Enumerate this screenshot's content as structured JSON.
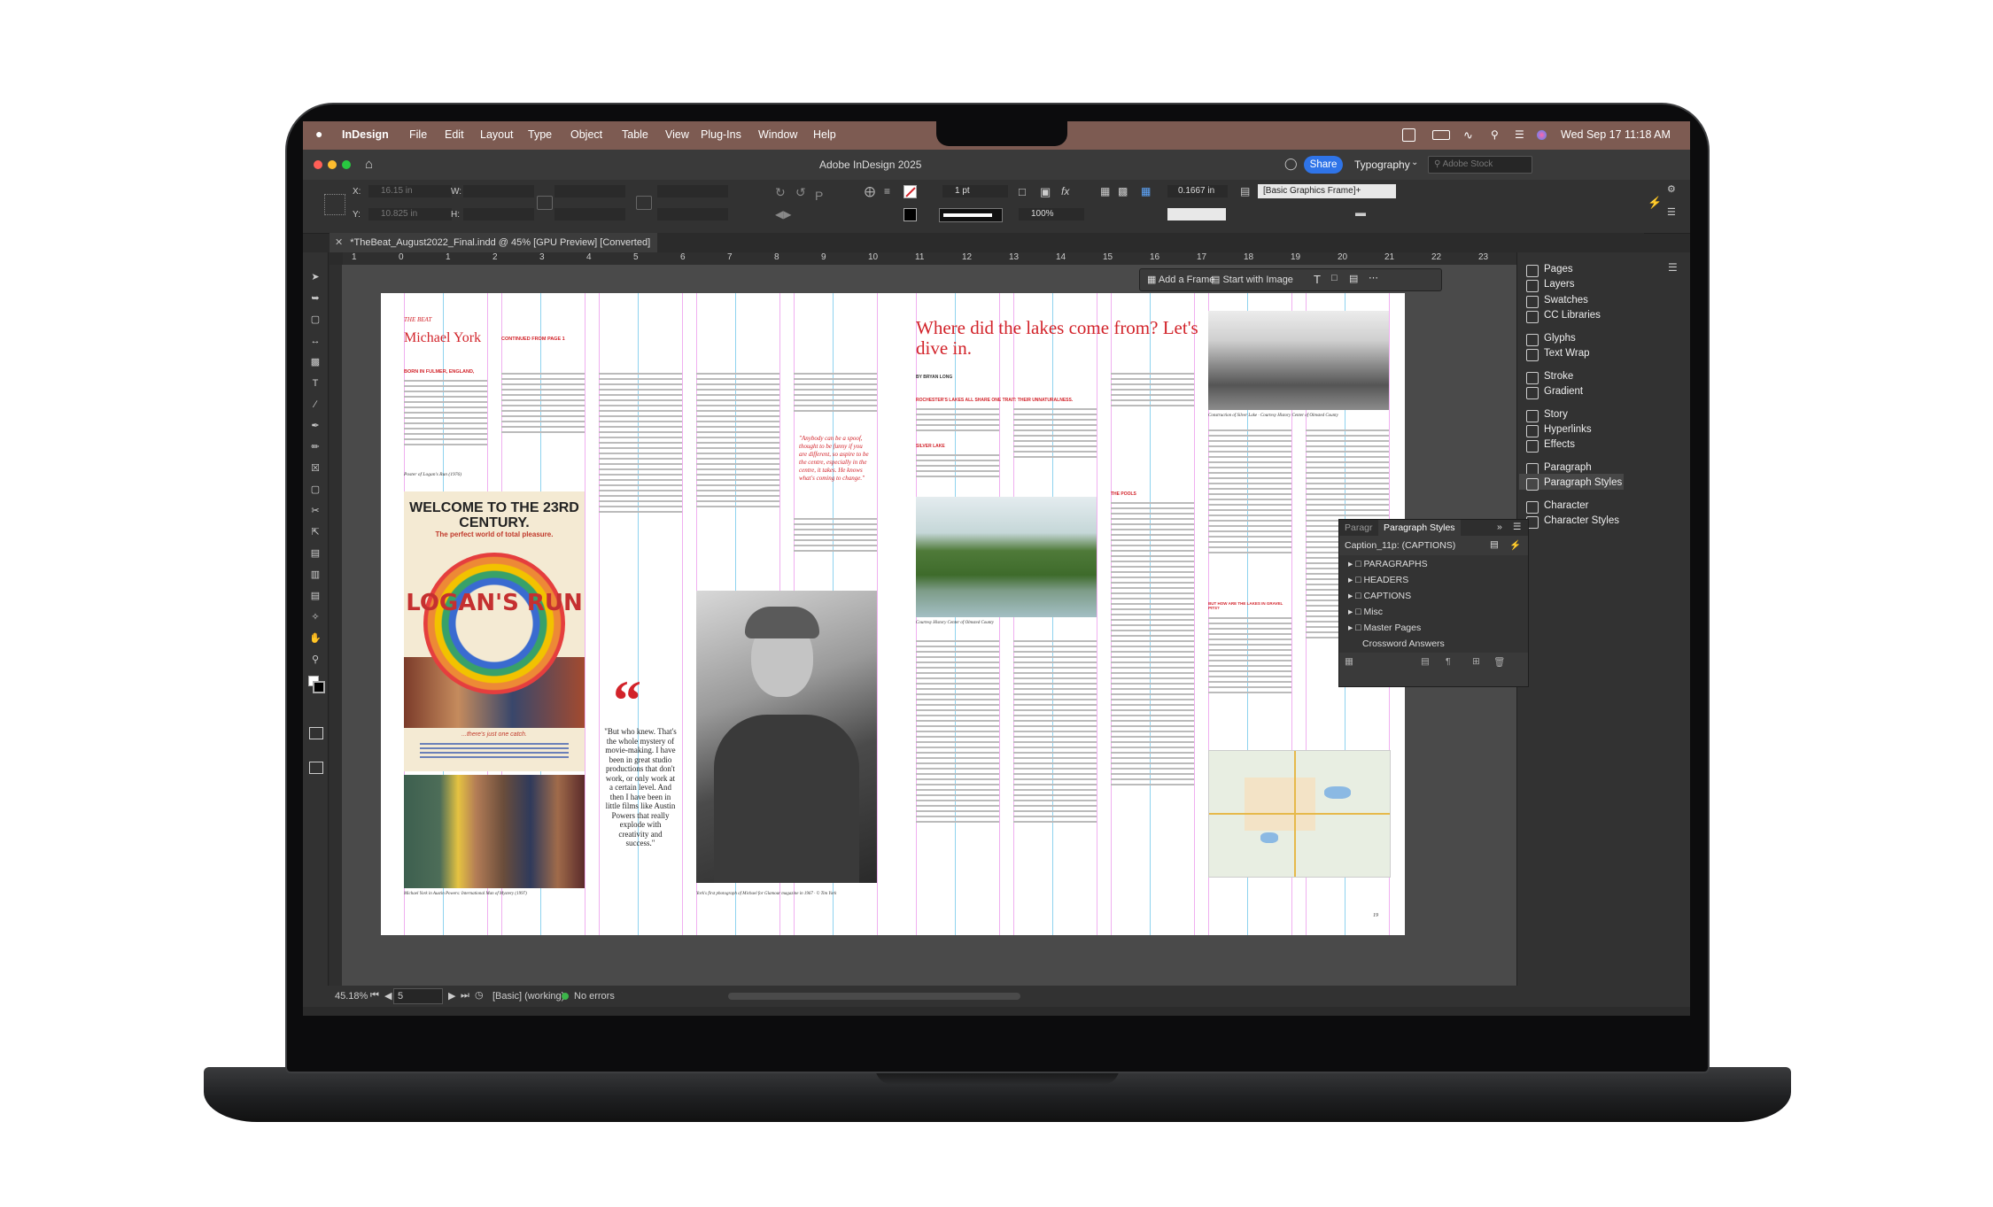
{
  "menubar": {
    "apple": "",
    "app": "InDesign",
    "items": [
      "File",
      "Edit",
      "Layout",
      "Type",
      "Object",
      "Table",
      "View",
      "Plug-Ins",
      "Window",
      "Help"
    ],
    "clock": "Wed Sep 17  11:18 AM"
  },
  "window": {
    "title": "Adobe InDesign 2025",
    "share": "Share",
    "workspace": "Typography",
    "search_placeholder": "Adobe Stock"
  },
  "control": {
    "x_label": "X:",
    "x_value": "16.15 in",
    "y_label": "Y:",
    "y_value": "10.825 in",
    "w_label": "W:",
    "h_label": "H:",
    "stroke_weight": "1 pt",
    "zoom_pct": "100%",
    "gap_value": "0.1667 in",
    "frame_style": "[Basic Graphics Frame]+"
  },
  "document_tab": {
    "label": "*TheBeat_August2022_Final.indd @ 45% [GPU Preview] [Converted]"
  },
  "ruler": {
    "marks": [
      "1",
      "0",
      "1",
      "2",
      "3",
      "4",
      "5",
      "6",
      "7",
      "8",
      "9",
      "10",
      "11",
      "12",
      "13",
      "14",
      "15",
      "16",
      "17",
      "18",
      "19",
      "20",
      "21",
      "22",
      "23"
    ]
  },
  "context_bar": {
    "add_frame": "Add a Frame",
    "start_with_image": "Start with Image"
  },
  "left_page": {
    "header": "THE BEAT",
    "name": "Michael York",
    "continued": "CONTINUED FROM PAGE 1",
    "born": "BORN IN FULMER, ENGLAND,",
    "poster_caption": "Poster of Logan's Run (1976)",
    "poster_title": "WELCOME TO THE 23RD CENTURY.",
    "poster_sub": "The perfect world of total pleasure.",
    "movie_name": "LOGAN'S RUN",
    "poster_tag": "...there's just one catch.",
    "photo_caption": "Michael York in Austin Powers: International Man of Mystery (1997)",
    "quote": "\"But who knew. That's the whole mystery of movie-making. I have been in great studio productions that don't work, or only work at a certain level. And then I have been in little films like Austin Powers that really explode with creativity and success.\"",
    "pullquote": "\"Anybody can be a spoof, thought to be funny if you are different, so aspire to be the centre, especially in the centre, it takes. He knows what's coming to change.\"",
    "portrait_caption": "York's first photograph of Michael for Glamour magazine in 1967 · © Tim York"
  },
  "right_page": {
    "headline": "Where did the lakes come from? Let's dive in.",
    "byline": "BY BRYAN LONG",
    "kicker": "ROCHESTER'S LAKES ALL SHARE ONE TRAIT: THEIR UNNATURALNESS.",
    "subhead1": "SILVER LAKE",
    "subhead2": "THE POOLS",
    "subhead3": "BUT HOW ARE THE LAKES IN GRAVEL PITS?",
    "photo1_caption": "Courtesy History Center of Olmsted County",
    "photo2_caption": "Construction of Silver Lake · Courtesy History Center of Olmsted County",
    "page_num": "19"
  },
  "paragraph_styles": {
    "tab_inactive": "Paragr",
    "tab_active": "Paragraph Styles",
    "current": "Caption_11p: (CAPTIONS)",
    "groups": [
      "PARAGRAPHS",
      "HEADERS",
      "CAPTIONS",
      "Misc",
      "Master Pages"
    ],
    "style_item": "Crossword Answers"
  },
  "side_panels": [
    {
      "label": "Pages",
      "icon": "pages-icon"
    },
    {
      "label": "Layers",
      "icon": "layers-icon"
    },
    {
      "label": "Swatches",
      "icon": "swatches-icon"
    },
    {
      "label": "CC Libraries",
      "icon": "cc-libraries-icon"
    },
    {
      "label": "Glyphs",
      "icon": "glyphs-icon"
    },
    {
      "label": "Text Wrap",
      "icon": "text-wrap-icon"
    },
    {
      "label": "Stroke",
      "icon": "stroke-icon"
    },
    {
      "label": "Gradient",
      "icon": "gradient-icon"
    },
    {
      "label": "Story",
      "icon": "story-icon"
    },
    {
      "label": "Hyperlinks",
      "icon": "hyperlinks-icon"
    },
    {
      "label": "Effects",
      "icon": "effects-icon"
    },
    {
      "label": "Paragraph",
      "icon": "paragraph-icon"
    },
    {
      "label": "Paragraph Styles",
      "icon": "paragraph-styles-icon"
    },
    {
      "label": "Character",
      "icon": "character-icon"
    },
    {
      "label": "Character Styles",
      "icon": "character-styles-icon"
    }
  ],
  "status": {
    "zoom": "45.18%",
    "page": "5",
    "preflight_profile": "[Basic] (working)",
    "errors": "No errors"
  },
  "colors": {
    "menubar": "#7d5b52",
    "share": "#2f74e8",
    "accent_red": "#d2232a",
    "ui_dark": "#323232"
  }
}
